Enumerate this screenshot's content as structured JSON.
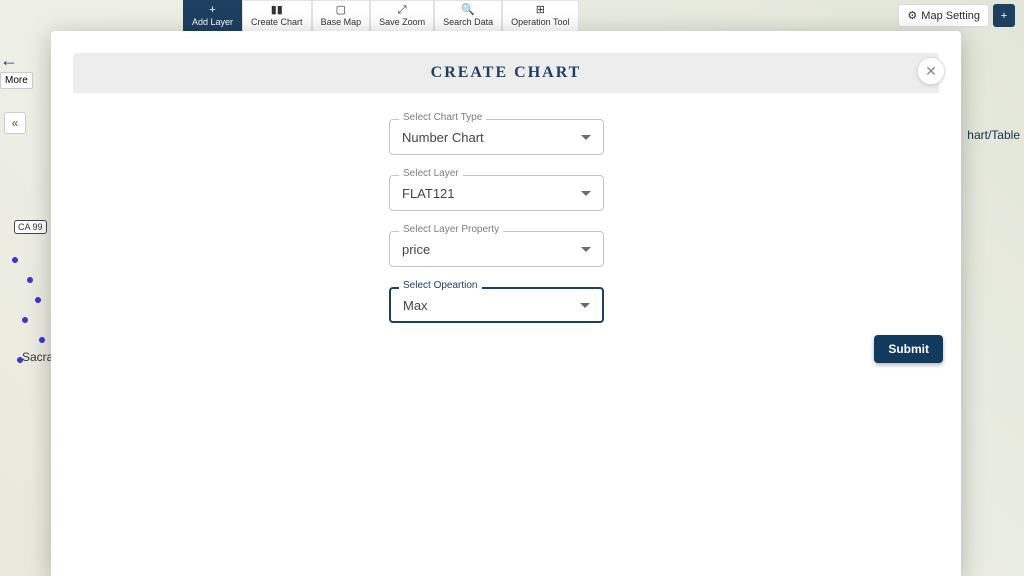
{
  "toolbar": {
    "add_layer": "Add Layer",
    "create_chart": "Create Chart",
    "base_map": "Base Map",
    "save_zoom": "Save Zoom",
    "search_data": "Search Data",
    "operation_tool": "Operation Tool"
  },
  "topright": {
    "map_setting": "Map Setting",
    "chart_table": "hart/Table"
  },
  "left": {
    "more": "More",
    "highway": "CA 99",
    "city": "Sacra"
  },
  "modal": {
    "title": "CREATE CHART",
    "fields": {
      "chart_type": {
        "label": "Select Chart Type",
        "value": "Number Chart"
      },
      "layer": {
        "label": "Select Layer",
        "value": "FLAT121"
      },
      "layer_property": {
        "label": "Select Layer Property",
        "value": "price"
      },
      "operation": {
        "label": "Select Opeartion",
        "value": "Max"
      }
    },
    "submit": "Submit"
  }
}
